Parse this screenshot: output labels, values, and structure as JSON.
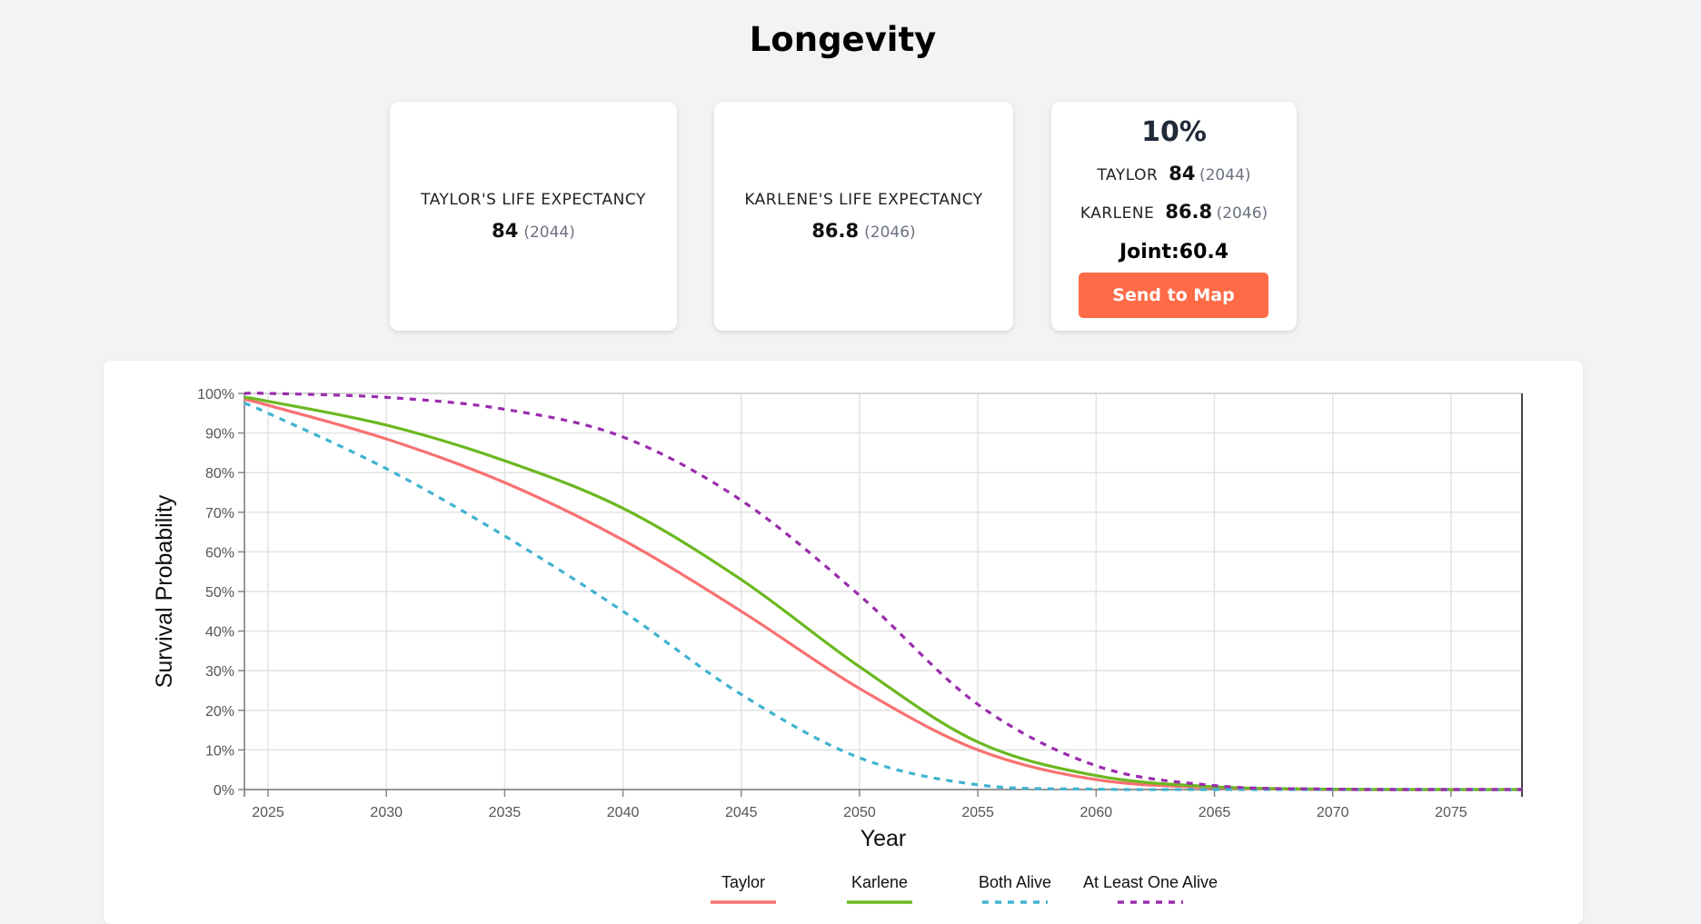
{
  "page": {
    "title": "Longevity"
  },
  "cards": {
    "taylor": {
      "label": "TAYLOR'S LIFE EXPECTANCY",
      "value": "84",
      "year": "(2044)"
    },
    "karlene": {
      "label": "KARLENE'S LIFE EXPECTANCY",
      "value": "86.8",
      "year": "(2046)"
    },
    "joint": {
      "percent": "10%",
      "rows": [
        {
          "name": "TAYLOR",
          "value": "84",
          "year": "(2044)"
        },
        {
          "name": "KARLENE",
          "value": "86.8",
          "year": "(2046)"
        }
      ],
      "joint_text": "Joint:60.4",
      "button_label": "Send to Map",
      "button_color": "#ff6b47"
    }
  },
  "chart_data": {
    "type": "line",
    "xlabel": "Year",
    "ylabel": "Survival Probability",
    "xlim": [
      2024,
      2078
    ],
    "ylim": [
      0,
      100
    ],
    "x_ticks": [
      2025,
      2030,
      2035,
      2040,
      2045,
      2050,
      2055,
      2060,
      2065,
      2070,
      2075
    ],
    "y_ticks": [
      0,
      10,
      20,
      30,
      40,
      50,
      60,
      70,
      80,
      90,
      100
    ],
    "y_tick_suffix": "%",
    "grid": true,
    "legend_position": "bottom",
    "x": [
      2024,
      2025,
      2030,
      2035,
      2040,
      2045,
      2050,
      2055,
      2060,
      2065,
      2070,
      2075,
      2078
    ],
    "series": [
      {
        "name": "Taylor",
        "color": "#f87171",
        "dashed": false,
        "values": [
          98.5,
          97,
          88.5,
          77.5,
          63,
          45,
          25.5,
          10,
          2.5,
          0.5,
          0,
          0,
          0
        ]
      },
      {
        "name": "Karlene",
        "color": "#6bb820",
        "dashed": false,
        "values": [
          99,
          98,
          92,
          83,
          71,
          53,
          31,
          12,
          3.5,
          0.7,
          0.1,
          0,
          0
        ]
      },
      {
        "name": "Both Alive",
        "color": "#3fb3d0",
        "dashed": true,
        "values": [
          97.5,
          95,
          81,
          64,
          45,
          24,
          8,
          1.2,
          0.1,
          0,
          0,
          0,
          0
        ]
      },
      {
        "name": "At Least One Alive",
        "color": "#9b2cae",
        "dashed": true,
        "values": [
          100,
          100,
          99,
          96,
          89,
          73,
          49,
          21.5,
          6,
          1,
          0.1,
          0,
          0
        ]
      }
    ]
  }
}
